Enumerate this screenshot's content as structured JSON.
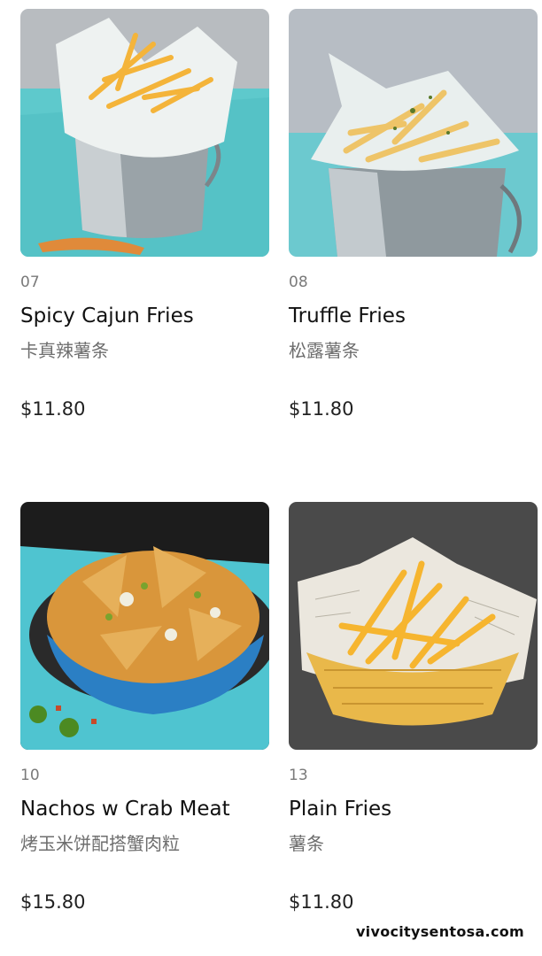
{
  "items": [
    {
      "code": "07",
      "name": "Spicy Cajun Fries",
      "name_cn": "卡真辣薯条",
      "price": "$11.80",
      "image_icon": "fries-bucket-image"
    },
    {
      "code": "08",
      "name": "Truffle Fries",
      "name_cn": "松露薯条",
      "price": "$11.80",
      "image_icon": "truffle-fries-bucket-image"
    },
    {
      "code": "10",
      "name": "Nachos w Crab Meat",
      "name_cn": "烤玉米饼配搭蟹肉粒",
      "price": "$15.80",
      "image_icon": "nachos-bowl-image"
    },
    {
      "code": "13",
      "name": "Plain Fries",
      "name_cn": "薯条",
      "price": "$11.80",
      "image_icon": "fries-basket-image"
    }
  ],
  "watermark": "vivocitysentosa.com",
  "colors": {
    "teal_table": "#5ec9cc",
    "dark_bg": "#4a4a4a",
    "fries": "#f4b43a"
  }
}
